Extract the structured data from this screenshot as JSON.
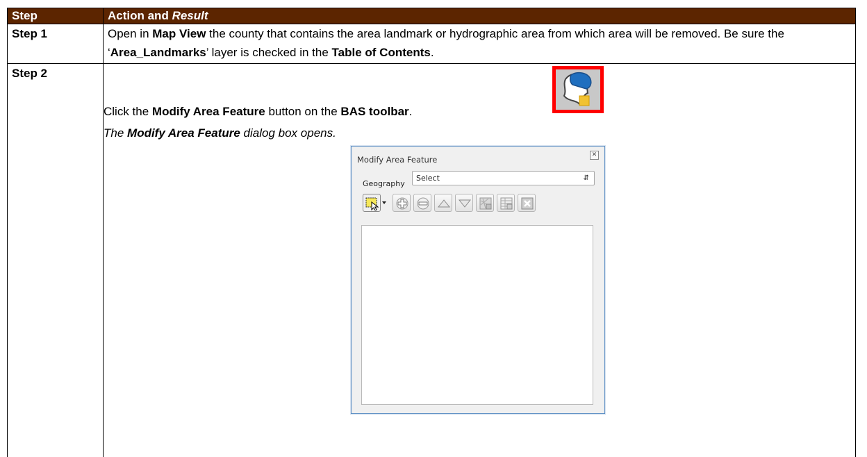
{
  "table": {
    "header": {
      "col1": "Step",
      "col2_prefix": "Action and ",
      "col2_italic": "Result"
    },
    "step1": {
      "label": "Step 1",
      "t1": "Open in ",
      "b1": "Map View",
      "t2": " the county that contains the area landmark or hydrographic area from which area will be removed. Be sure the ‘",
      "b2": "Area_Landmarks",
      "t3": "’ layer is checked in the ",
      "b3": "Table of Contents",
      "t4": "."
    },
    "step2": {
      "label": "Step 2",
      "t1": "Click the ",
      "b1": "Modify Area Feature",
      "t2": " button on the ",
      "b2": "BAS toolbar",
      "t3": ".",
      "result_bold": "Modify Area Feature",
      "result_rest": " dialog box opens.",
      "result_prefix": "The "
    }
  },
  "dialog": {
    "title": "Modify Area Feature",
    "close_glyph": "✕",
    "geography_label": "Geography",
    "geography_value": "Select",
    "toolbar_icons": [
      "select-feature-icon",
      "dropdown-arrow-icon",
      "add-icon",
      "remove-icon",
      "move-up-icon",
      "move-down-icon",
      "map-icon",
      "table-icon",
      "cancel-icon"
    ]
  }
}
